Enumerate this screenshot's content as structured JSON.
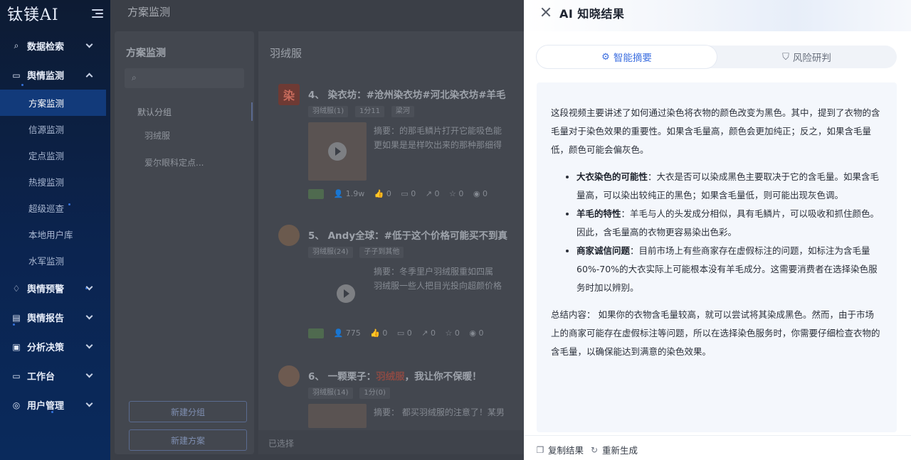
{
  "app": {
    "logo": "钛镁AI"
  },
  "sidebar": {
    "items": [
      {
        "label": "数据检索",
        "icon": "search-icon",
        "glyph": "⌕"
      },
      {
        "label": "舆情监测",
        "icon": "monitor-icon",
        "glyph": "▭",
        "children": [
          "方案监测",
          "信源监测",
          "定点监测",
          "热搜监测",
          "超级巡查",
          "本地用户库",
          "水军监测"
        ]
      },
      {
        "label": "舆情预警",
        "icon": "bell-icon",
        "glyph": "♢"
      },
      {
        "label": "舆情报告",
        "icon": "report-icon",
        "glyph": "▤"
      },
      {
        "label": "分析决策",
        "icon": "chart-icon",
        "glyph": "▣"
      },
      {
        "label": "工作台",
        "icon": "workbench-icon",
        "glyph": "▭"
      },
      {
        "label": "用户管理",
        "icon": "user-icon",
        "glyph": "◎"
      }
    ],
    "active_child": "方案监测"
  },
  "main": {
    "breadcrumb": "方案监测",
    "left_panel": {
      "title": "方案监测",
      "group": "默认分组",
      "plans": [
        "羽绒服",
        "爱尔眼科定点..."
      ],
      "buttons": [
        "新建分组",
        "新建方案"
      ]
    },
    "right_panel": {
      "title": "羽绒服",
      "cards": [
        {
          "index": "4、",
          "author": "染衣坊",
          "title": "#沧州染衣坊#河北染衣坊#羊毛",
          "tags": [
            "羽绒服(1)",
            "1分11",
            "梁河"
          ],
          "summary": [
            "摘要：的那毛鳞片打开它能吸色能",
            "更如果是是样吹出来的那种那细得"
          ],
          "stats": [
            "1.9w",
            "0",
            "0",
            "0",
            "0",
            "0"
          ]
        },
        {
          "index": "5、",
          "author": "Andy全球",
          "title": "#低于这个价格可能买不到真",
          "tags": [
            "羽绒服(24)",
            "子子到其他"
          ],
          "summary": [
            "摘要：冬季里户羽绒服重如四属",
            "羽绒服一些人把目光投向超颜价格"
          ],
          "stats": [
            "775",
            "0",
            "0",
            "0",
            "0",
            "0"
          ]
        },
        {
          "index": "6、",
          "author": "一颗栗子",
          "title_prefix": "",
          "title_hl": "羽绒服",
          "title_suffix": "，我让你不保暖！",
          "tags": [
            "羽绒服(14)",
            "1分(0)"
          ],
          "summary": [
            "摘要：  都买羽绒服的注意了！某男"
          ],
          "stats": []
        }
      ],
      "footer": "已选择"
    }
  },
  "drawer": {
    "title": "AI 知晓结果",
    "tabs": [
      {
        "label": "智能摘要",
        "icon": "gear-icon",
        "active": true
      },
      {
        "label": "风险研判",
        "icon": "shield-icon",
        "active": false
      }
    ],
    "intro": "这段视频主要讲述了如何通过染色将衣物的颜色改变为黑色。其中，提到了衣物的含毛量对于染色效果的重要性。如果含毛量高，颜色会更加纯正；反之，如果含毛量低，颜色可能会偏灰色。",
    "bullets": [
      {
        "title": "大衣染色的可能性",
        "text": "：大衣是否可以染成黑色主要取决于它的含毛量。如果含毛量高，可以染出较纯正的黑色；如果含毛量低，则可能出现灰色调。"
      },
      {
        "title": "羊毛的特性",
        "text": "：羊毛与人的头发成分相似，具有毛鳞片，可以吸收和抓住颜色。因此，含毛量高的衣物更容易染出色彩。"
      },
      {
        "title": "商家诚信问题",
        "text": "：目前市场上有些商家存在虚假标注的问题，如标注为含毛量60%-70%的大衣实际上可能根本没有羊毛成分。这需要消费者在选择染色服务时加以辨别。"
      }
    ],
    "conclusion": "总结内容： 如果你的衣物含毛量较高，就可以尝试将其染成黑色。然而，由于市场上的商家可能存在虚假标注等问题，所以在选择染色服务时，你需要仔细检查衣物的含毛量，以确保能达到满意的染色效果。",
    "footer": {
      "copy": "复制结果",
      "regenerate": "重新生成"
    }
  },
  "colors": {
    "accent": "#3d6fe0",
    "sidebar_bg": "#0b2450",
    "overlay": "#3b3f47"
  }
}
